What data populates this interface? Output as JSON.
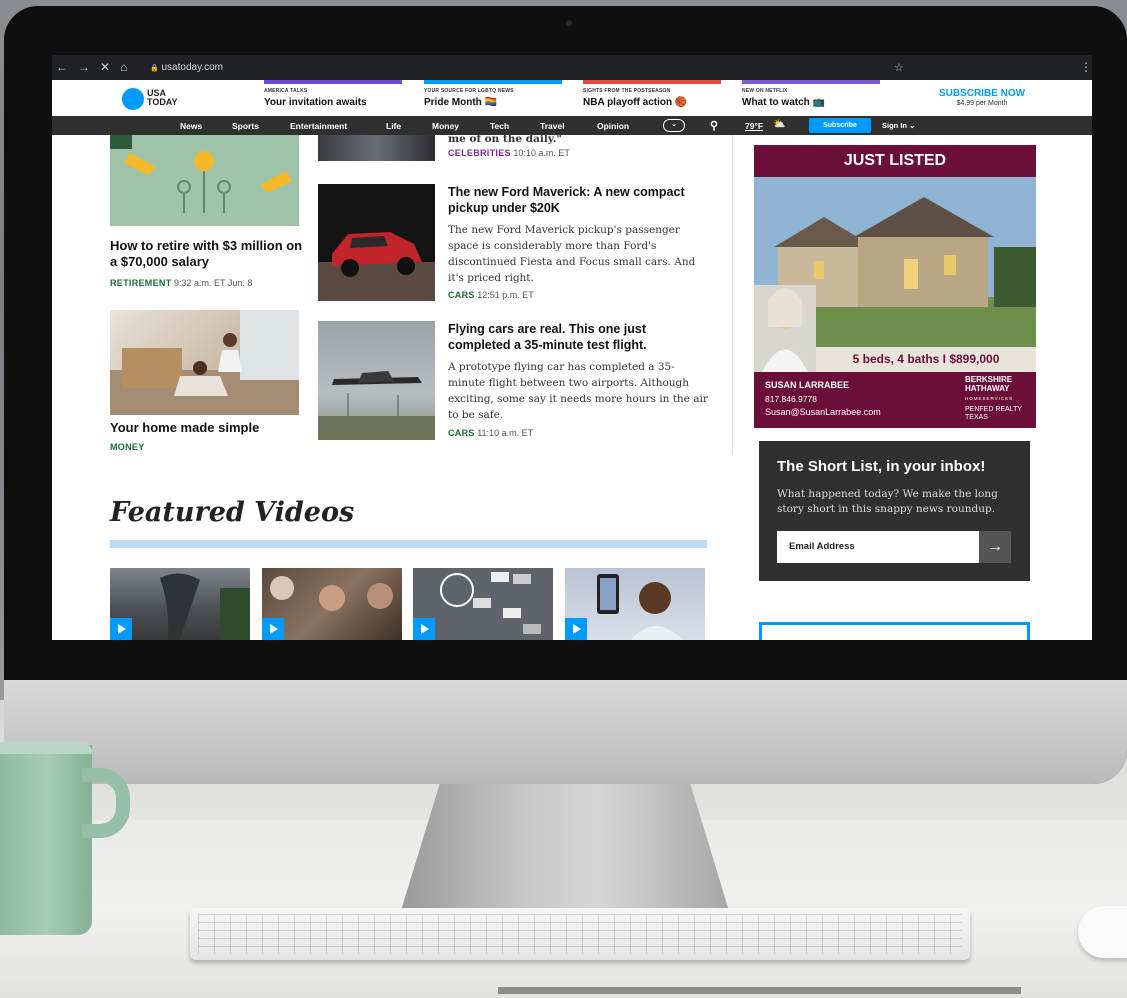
{
  "browser": {
    "back": "←",
    "forward": "→",
    "stop": "✕",
    "home": "⌂",
    "lock": "🔒",
    "url": "usatoday.com",
    "star": "☆",
    "menu": "⋮"
  },
  "header": {
    "logo_line1": "USA",
    "logo_line2": "TODAY",
    "promos": [
      {
        "kicker": "AMERICA TALKS",
        "title": "Your invitation awaits",
        "color": "#6c4bd6"
      },
      {
        "kicker": "YOUR SOURCE FOR LGBTQ NEWS",
        "title": "Pride Month 🏳️‍🌈",
        "color": "#009bff"
      },
      {
        "kicker": "SIGHTS FROM THE POSTSEASON",
        "title": "NBA playoff action 🏀",
        "color": "#e8483a"
      },
      {
        "kicker": "NEW ON NETFLIX",
        "title": "What to watch 📺",
        "color": "#7a5cd6"
      }
    ],
    "subscribe_title": "SUBSCRIBE NOW",
    "subscribe_price": "$4.99 per Month"
  },
  "nav": {
    "items": [
      "News",
      "Sports",
      "Entertainment",
      "Life",
      "Money",
      "Tech",
      "Travel",
      "Opinion"
    ],
    "more_icon": "⌄",
    "search_icon": "⚲",
    "weather": "79°F",
    "weather_icon": "⛅",
    "subscribe": "Subscribe",
    "signin": "Sign In ⌄"
  },
  "left_column": [
    {
      "title": "How to retire with $3 million on a $70,000 salary",
      "category": "RETIREMENT",
      "time": "9:32 a.m. ET Jun. 8"
    },
    {
      "title": "Your home made simple",
      "category": "MONEY"
    }
  ],
  "middle_column": [
    {
      "partial_text": "me of on the daily.\"",
      "category": "CELEBRITIES",
      "time": "10:10 a.m. ET"
    },
    {
      "title": "The new Ford Maverick: A new compact pickup under $20K",
      "desc": "The new Ford Maverick pickup's passenger space is considerably more than Ford's discontinued Fiesta and Focus small cars. And it's priced right.",
      "category": "CARS",
      "time": "12:51 p.m. ET"
    },
    {
      "title": "Flying cars are real. This one just completed a 35-minute test flight.",
      "desc": "A prototype flying car has completed a 35-minute flight between two airports. Although exciting, some say it needs more hours in the air to be safe.",
      "category": "CARS",
      "time": "11:10 a.m. ET"
    }
  ],
  "colors": {
    "accent": "#009bff",
    "retirement": "#1f6b3a",
    "celebrities": "#7a2a8c",
    "cars": "#1f6b3a",
    "ad_maroon": "#6b0f3a"
  },
  "featured": {
    "title": "Featured Videos"
  },
  "ad": {
    "header": "JUST LISTED",
    "details": "5 beds, 4 baths I $899,000",
    "agent_name": "SUSAN LARRABEE",
    "agent_phone": "817.846.9778",
    "agent_email": "Susan@SusanLarrabee.com",
    "brand_line1": "BERKSHIRE",
    "brand_line2": "HATHAWAY",
    "brand_line3": "HOMESERVICES",
    "brand_line4": "PENFED REALTY",
    "brand_line5": "TEXAS"
  },
  "newsletter": {
    "title": "The Short List, in your inbox!",
    "desc": "What happened today? We make the long story short in this snappy news roundup.",
    "placeholder": "Email Address",
    "submit": "→"
  }
}
